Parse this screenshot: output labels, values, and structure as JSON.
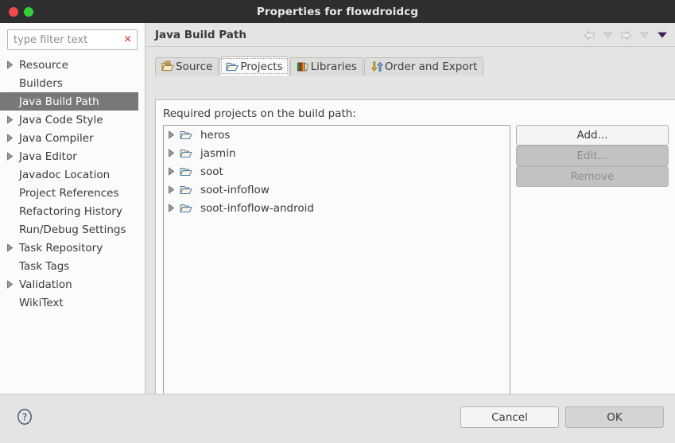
{
  "window": {
    "title": "Properties for flowdroidcg",
    "controls": {
      "close": "close-button",
      "maximize": "maximize-button"
    },
    "colors": {
      "titlebar_bg": "#2e2e2e",
      "close_red": "#ee4b4b",
      "maximize_green": "#36d03a",
      "dialog_bg": "#e4e4e2",
      "selection_gray": "#787878",
      "clear_red": "#e03c31"
    }
  },
  "sidebar": {
    "filter": {
      "placeholder": "type filter text",
      "value": "",
      "clear_icon": "clear-x-icon"
    },
    "items": [
      {
        "label": "Resource",
        "expandable": true,
        "selected": false
      },
      {
        "label": "Builders",
        "expandable": false,
        "selected": false
      },
      {
        "label": "Java Build Path",
        "expandable": false,
        "selected": true
      },
      {
        "label": "Java Code Style",
        "expandable": true,
        "selected": false
      },
      {
        "label": "Java Compiler",
        "expandable": true,
        "selected": false
      },
      {
        "label": "Java Editor",
        "expandable": true,
        "selected": false
      },
      {
        "label": "Javadoc Location",
        "expandable": false,
        "selected": false
      },
      {
        "label": "Project References",
        "expandable": false,
        "selected": false
      },
      {
        "label": "Refactoring History",
        "expandable": false,
        "selected": false
      },
      {
        "label": "Run/Debug Settings",
        "expandable": false,
        "selected": false
      },
      {
        "label": "Task Repository",
        "expandable": true,
        "selected": false
      },
      {
        "label": "Task Tags",
        "expandable": false,
        "selected": false
      },
      {
        "label": "Validation",
        "expandable": true,
        "selected": false
      },
      {
        "label": "WikiText",
        "expandable": false,
        "selected": false
      }
    ]
  },
  "header": {
    "title": "Java Build Path",
    "nav": [
      {
        "name": "back-arrow-icon"
      },
      {
        "name": "back-dropdown-icon"
      },
      {
        "name": "forward-arrow-icon"
      },
      {
        "name": "forward-dropdown-icon"
      },
      {
        "name": "menu-dropdown-icon"
      }
    ]
  },
  "tabs": [
    {
      "label": "Source",
      "icon": "source-folder-icon",
      "active": false
    },
    {
      "label": "Projects",
      "icon": "projects-folder-icon",
      "active": true
    },
    {
      "label": "Libraries",
      "icon": "libraries-books-icon",
      "active": false
    },
    {
      "label": "Order and Export",
      "icon": "order-export-arrows-icon",
      "active": false
    }
  ],
  "panel": {
    "label": "Required projects on the build path:",
    "projects": [
      {
        "name": "heros",
        "icon": "folder-icon",
        "expandable": true
      },
      {
        "name": "jasmin",
        "icon": "folder-icon",
        "expandable": true
      },
      {
        "name": "soot",
        "icon": "folder-icon",
        "expandable": true
      },
      {
        "name": "soot-infoflow",
        "icon": "folder-icon",
        "expandable": true
      },
      {
        "name": "soot-infoflow-android",
        "icon": "folder-icon",
        "expandable": true
      }
    ],
    "buttons": [
      {
        "label": "Add...",
        "enabled": true
      },
      {
        "label": "Edit...",
        "enabled": false
      },
      {
        "label": "Remove",
        "enabled": false
      }
    ]
  },
  "footer": {
    "help_icon": "help-question-icon",
    "cancel_label": "Cancel",
    "ok_label": "OK"
  }
}
